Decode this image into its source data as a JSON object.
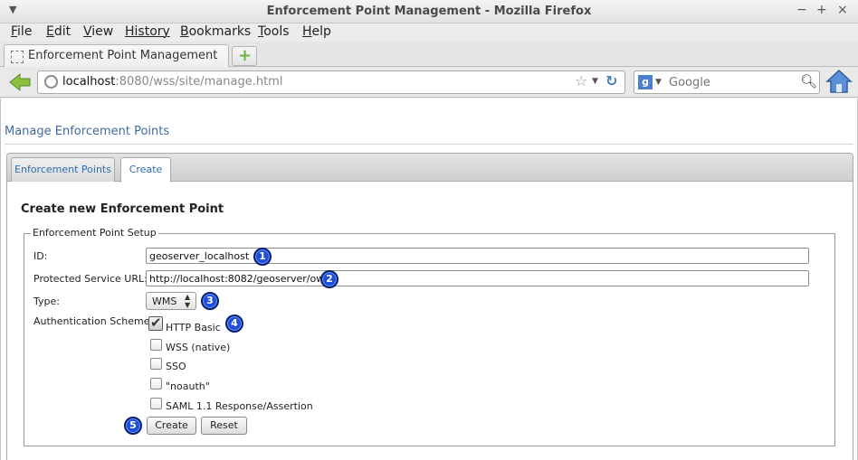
{
  "window": {
    "title": "Enforcement Point Management - Mozilla Firefox",
    "controls": [
      "−",
      "+",
      "×"
    ]
  },
  "menubar": {
    "items": [
      {
        "key": "F",
        "rest": "ile"
      },
      {
        "key": "E",
        "rest": "dit"
      },
      {
        "key": "V",
        "rest": "iew"
      },
      {
        "key": "Hi",
        "rest": "story",
        "underline_index": 2
      },
      {
        "key": "B",
        "rest": "ookmarks"
      },
      {
        "key": "T",
        "rest": "ools"
      },
      {
        "key": "H",
        "rest": "elp"
      }
    ],
    "labels": [
      "File",
      "Edit",
      "View",
      "History",
      "Bookmarks",
      "Tools",
      "Help"
    ]
  },
  "browser_tab": {
    "label": "Enforcement Point Management",
    "new_tab_symbol": "+"
  },
  "navbar": {
    "url_host": "localhost",
    "url_rest": ":8080/wss/site/manage.html",
    "search_engine_letter": "g",
    "search_placeholder": "Google"
  },
  "page": {
    "title": "Manage Enforcement Points",
    "tabs": [
      {
        "label": "Enforcement Points",
        "active": false
      },
      {
        "label": "Create",
        "active": true
      }
    ],
    "form_title": "Create new Enforcement Point",
    "fieldset_legend": "Enforcement Point Setup",
    "fields": {
      "id_label": "ID:",
      "id_value": "geoserver_localhost",
      "url_label": "Protected Service URL:",
      "url_value": "http://localhost:8082/geoserver/ows?",
      "type_label": "Type:",
      "type_value": "WMS",
      "auth_label": "Authentication Schemes:"
    },
    "auth_schemes": [
      {
        "label": "HTTP Basic",
        "checked": true
      },
      {
        "label": "WSS (native)",
        "checked": false
      },
      {
        "label": "SSO",
        "checked": false
      },
      {
        "label": "\"noauth\"",
        "checked": false
      },
      {
        "label": "SAML 1.1 Response/Assertion",
        "checked": false
      }
    ],
    "buttons": {
      "create": "Create",
      "reset": "Reset"
    }
  },
  "markers": [
    "1",
    "2",
    "3",
    "4",
    "5"
  ],
  "colors": {
    "link_blue": "#3f6b9e",
    "tab_text_blue": "#2d6db5",
    "marker_blue": "#1f4fd8"
  }
}
